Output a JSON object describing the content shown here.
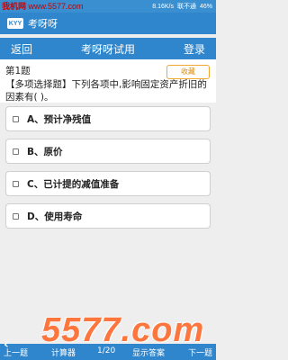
{
  "status": {
    "watermark_cn": "我机网",
    "watermark_en": "www.5577.com",
    "net_speed": "8.16K/s",
    "carrier": "联不通",
    "battery": "46%"
  },
  "app": {
    "logo": "KYY",
    "title": "考呀呀"
  },
  "nav": {
    "back": "返回",
    "title": "考呀呀试用",
    "login": "登录"
  },
  "question": {
    "number": "第1题",
    "favorite": "收藏",
    "text": "【多项选择题】下列各项中,影响固定资产折旧的因素有( )。"
  },
  "options": [
    {
      "label": "A、预计净残值"
    },
    {
      "label": "B、原价"
    },
    {
      "label": "C、已计提的减值准备"
    },
    {
      "label": "D、使用寿命"
    }
  ],
  "bottom": {
    "prev": "上一题",
    "calc": "计算器",
    "page": "1/20",
    "show_answer": "显示答案",
    "next": "下一题"
  },
  "watermark_bottom": "5577.com",
  "colors": {
    "primary": "#2f86cc",
    "favorite_border": "#f0a830",
    "watermark": "#ff6a2a"
  }
}
